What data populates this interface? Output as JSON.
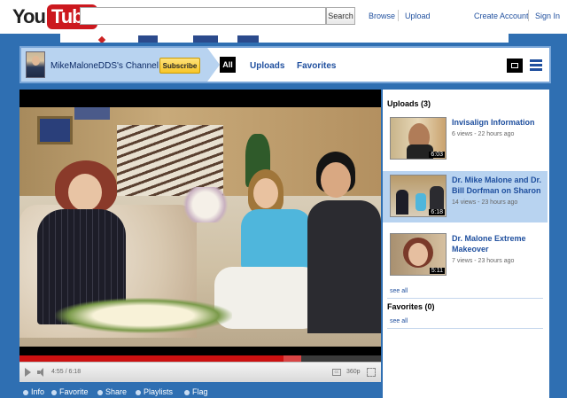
{
  "header": {
    "logo_you": "You",
    "logo_tube": "Tube",
    "search_placeholder": "",
    "search_button": "Search",
    "links": [
      "Browse",
      "Upload",
      "Create Account",
      "Sign In"
    ]
  },
  "channel": {
    "name": "MikeMaloneDDS's Channel",
    "subscribe_label": "Subscribe",
    "tabs": [
      "All",
      "Uploads",
      "Favorites"
    ]
  },
  "player": {
    "time": "4:55 / 6:18",
    "quality": "360p",
    "progress_fraction": 0.73,
    "buffered_fraction": 0.78
  },
  "actions": [
    "Info",
    "Favorite",
    "Share",
    "Playlists",
    "Flag"
  ],
  "sidebar": {
    "uploads_heading": "Uploads (3)",
    "uploads": [
      {
        "title": "Invisalign Information",
        "meta": "6 views - 22 hours ago",
        "duration": "6:03",
        "selected": false
      },
      {
        "title": "Dr. Mike Malone and Dr. Bill Dorfman on Sharon",
        "meta": "14 views - 23 hours ago",
        "duration": "6:18",
        "selected": true
      },
      {
        "title": "Dr. Malone Extreme Makeover",
        "meta": "7 views - 23 hours ago",
        "duration": "5:11",
        "selected": false
      }
    ],
    "see_all_label": "see all",
    "favorites_heading": "Favorites (0)",
    "favorites_see_all": "see all"
  },
  "colors": {
    "page_blue": "#2f6fb2",
    "link_blue": "#1f4f9e",
    "selected_row": "#b8d3f0",
    "subscribe_yellow": "#f7c629",
    "logo_red": "#cc181e"
  }
}
